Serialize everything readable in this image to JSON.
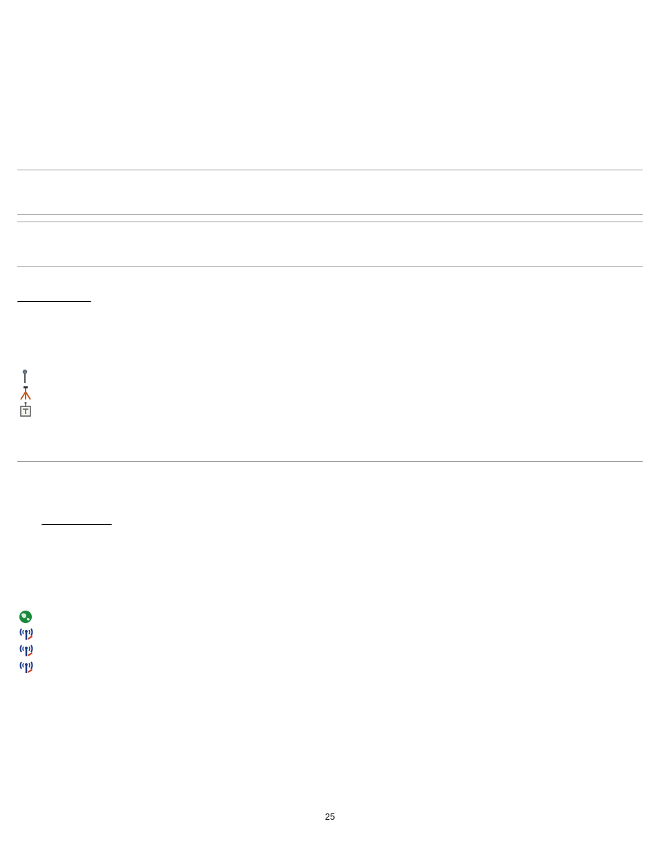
{
  "page_number": "25",
  "icons_group_1": [
    {
      "name": "pin-icon"
    },
    {
      "name": "tripod-icon"
    },
    {
      "name": "box-t-icon"
    }
  ],
  "icons_group_2": [
    {
      "name": "globe-icon"
    },
    {
      "name": "antenna-icon-1"
    },
    {
      "name": "antenna-icon-2"
    },
    {
      "name": "antenna-icon-3"
    }
  ]
}
